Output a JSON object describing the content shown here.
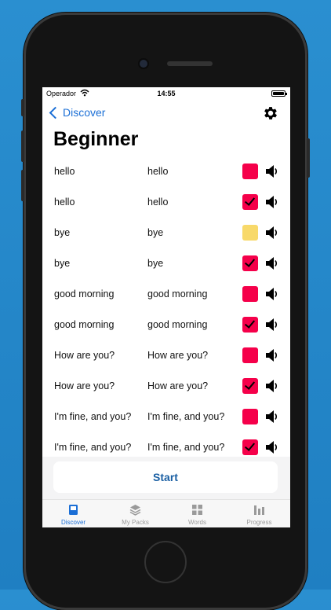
{
  "status_bar": {
    "carrier": "Operador",
    "time": "14:55"
  },
  "nav": {
    "back_label": "Discover"
  },
  "page_title": "Beginner",
  "colors": {
    "accent": "#1b6fd6",
    "box_red": "#f5004a",
    "box_yellow": "#f8d96a"
  },
  "words": [
    {
      "word": "hello",
      "translation": "hello",
      "state": "red",
      "checked": false
    },
    {
      "word": "hello",
      "translation": "hello",
      "state": "red",
      "checked": true
    },
    {
      "word": "bye",
      "translation": "bye",
      "state": "yellow",
      "checked": false
    },
    {
      "word": "bye",
      "translation": "bye",
      "state": "red",
      "checked": true
    },
    {
      "word": "good morning",
      "translation": "good morning",
      "state": "red",
      "checked": false
    },
    {
      "word": "good morning",
      "translation": "good morning",
      "state": "red",
      "checked": true
    },
    {
      "word": "How are you?",
      "translation": "How are you?",
      "state": "red",
      "checked": false
    },
    {
      "word": "How are you?",
      "translation": "How are you?",
      "state": "red",
      "checked": true
    },
    {
      "word": "I'm fine, and you?",
      "translation": "I'm fine, and you?",
      "state": "red",
      "checked": false
    },
    {
      "word": "I'm fine, and you?",
      "translation": "I'm fine, and you?",
      "state": "red",
      "checked": true
    }
  ],
  "start_button": {
    "label": "Start"
  },
  "tabs": [
    {
      "label": "Discover",
      "icon": "book-icon",
      "active": true
    },
    {
      "label": "My Packs",
      "icon": "layers-icon",
      "active": false
    },
    {
      "label": "Words",
      "icon": "grid-icon",
      "active": false
    },
    {
      "label": "Progress",
      "icon": "bar-chart-icon",
      "active": false
    }
  ]
}
